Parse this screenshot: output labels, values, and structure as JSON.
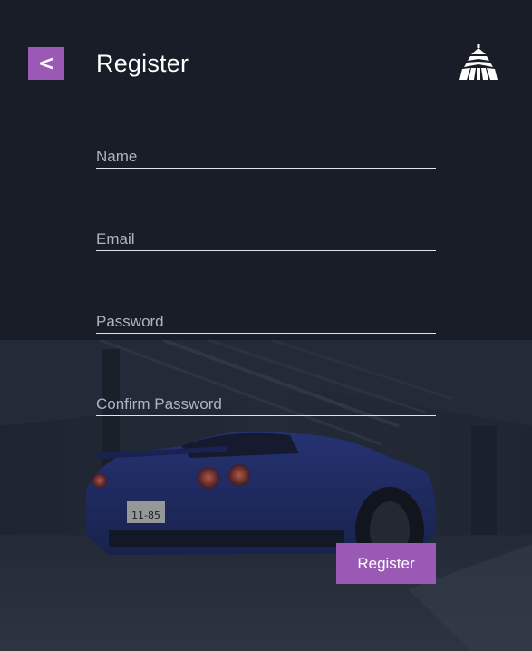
{
  "header": {
    "back_label": "<",
    "title": "Register",
    "logo_icon": "stylized-tree-logo-icon"
  },
  "form": {
    "name_placeholder": "Name",
    "email_placeholder": "Email",
    "password_placeholder": "Password",
    "confirm_placeholder": "Confirm Password",
    "submit_label": "Register"
  },
  "background": {
    "plate_text": "11-85"
  },
  "colors": {
    "accent": "#9a59b5",
    "background": "#181d28",
    "text": "#ffffff",
    "placeholder": "#aeb4c2"
  }
}
